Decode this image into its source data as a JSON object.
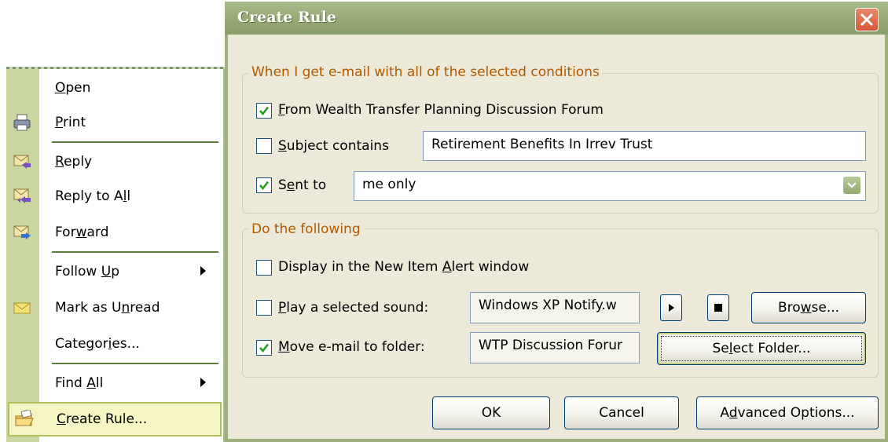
{
  "menu": {
    "items": [
      {
        "pre": "",
        "acc": "O",
        "post": "pen"
      },
      {
        "pre": "",
        "acc": "P",
        "post": "rint"
      },
      {
        "pre": "",
        "acc": "R",
        "post": "eply"
      },
      {
        "pre": "Reply to A",
        "acc": "l",
        "post": "l"
      },
      {
        "pre": "For",
        "acc": "w",
        "post": "ard"
      },
      {
        "pre": "Follow ",
        "acc": "U",
        "post": "p"
      },
      {
        "pre": "Mark as U",
        "acc": "n",
        "post": "read"
      },
      {
        "pre": "Categor",
        "acc": "i",
        "post": "es..."
      },
      {
        "pre": "Find ",
        "acc": "A",
        "post": "ll"
      },
      {
        "pre": "",
        "acc": "C",
        "post": "reate Rule..."
      }
    ]
  },
  "dialog": {
    "title": "Create Rule",
    "conditions_group": "When I get e-mail with all of the selected conditions",
    "from_label": {
      "pre": "",
      "acc": "F",
      "post": "rom Wealth Transfer Planning Discussion Forum"
    },
    "subject_label": {
      "pre": "",
      "acc": "S",
      "post": "ubject contains"
    },
    "subject_value": "Retirement Benefits In Irrev Trust",
    "sent_label": {
      "pre": "S",
      "acc": "e",
      "post": "nt to"
    },
    "sent_value": "me only",
    "actions_group": "Do the following",
    "display_label": {
      "pre": "Display in the New Item ",
      "acc": "A",
      "post": "lert window"
    },
    "sound_label": {
      "pre": "",
      "acc": "P",
      "post": "lay a selected sound:"
    },
    "sound_value": "Windows XP Notify.w",
    "browse_label": {
      "pre": "Bro",
      "acc": "w",
      "post": "se..."
    },
    "move_label": {
      "pre": "",
      "acc": "M",
      "post": "ove e-mail to folder:"
    },
    "folder_value": "WTP Discussion Forur",
    "select_folder_label": {
      "pre": "Se",
      "acc": "l",
      "post": "ect Folder..."
    },
    "ok_label": "OK",
    "cancel_label": "Cancel",
    "advanced_label": {
      "pre": "A",
      "acc": "d",
      "post": "vanced Options..."
    },
    "checked": {
      "from": true,
      "subject": false,
      "sent": true,
      "display": false,
      "sound": false,
      "move": true
    }
  },
  "colors": {
    "group_title": "#b05a00",
    "title_bar": "#94a774",
    "menu_strip": "#c9d6a0",
    "checkmark": "#21a121"
  }
}
